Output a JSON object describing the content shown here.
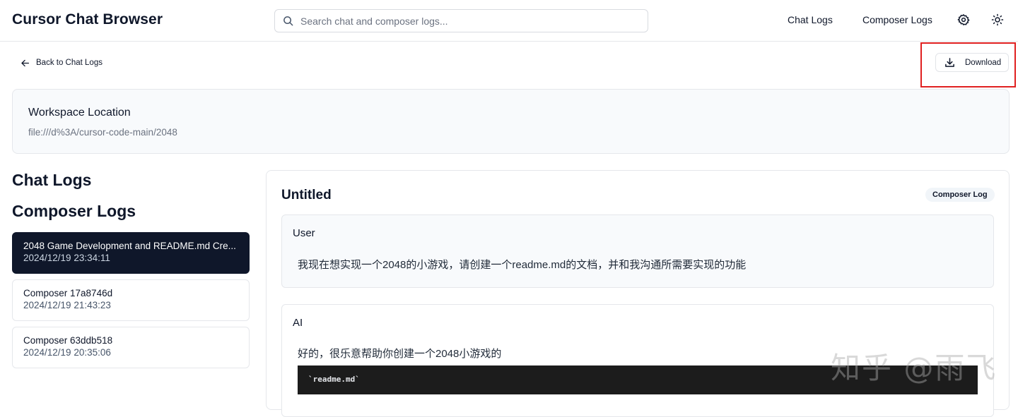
{
  "app": {
    "title": "Cursor Chat Browser"
  },
  "search": {
    "placeholder": "Search chat and composer logs...",
    "value": ""
  },
  "nav": {
    "chat_logs": "Chat Logs",
    "composer_logs": "Composer Logs"
  },
  "icons": {
    "search": "search-icon",
    "settings": "gear-icon",
    "theme": "sun-icon",
    "back": "arrow-left-icon",
    "download": "download-icon"
  },
  "toolbar": {
    "back_label": "Back to Chat Logs",
    "download_label": "Download"
  },
  "workspace": {
    "title": "Workspace Location",
    "path": "file:///d%3A/cursor-code-main/2048"
  },
  "sidebar": {
    "chat_heading": "Chat Logs",
    "composer_heading": "Composer Logs",
    "items": [
      {
        "title": "2048 Game Development and README.md Cre...",
        "date": "2024/12/19 23:34:11",
        "active": true
      },
      {
        "title": "Composer 17a8746d",
        "date": "2024/12/19 21:43:23",
        "active": false
      },
      {
        "title": "Composer 63ddb518",
        "date": "2024/12/19 20:35:06",
        "active": false
      }
    ]
  },
  "conversation": {
    "title": "Untitled",
    "badge": "Composer Log",
    "messages": [
      {
        "role": "User",
        "text": "我现在想实现一个2048的小游戏，请创建一个readme.md的文档，并和我沟通所需要实现的功能"
      },
      {
        "role": "AI",
        "text": "好的，很乐意帮助你创建一个2048小游戏的",
        "code": "`readme.md`"
      }
    ]
  },
  "watermark": "知乎 @雨飞",
  "colors": {
    "accent_dark": "#0f172a",
    "highlight": "#e02020",
    "code_bg": "#1c1c1c"
  }
}
